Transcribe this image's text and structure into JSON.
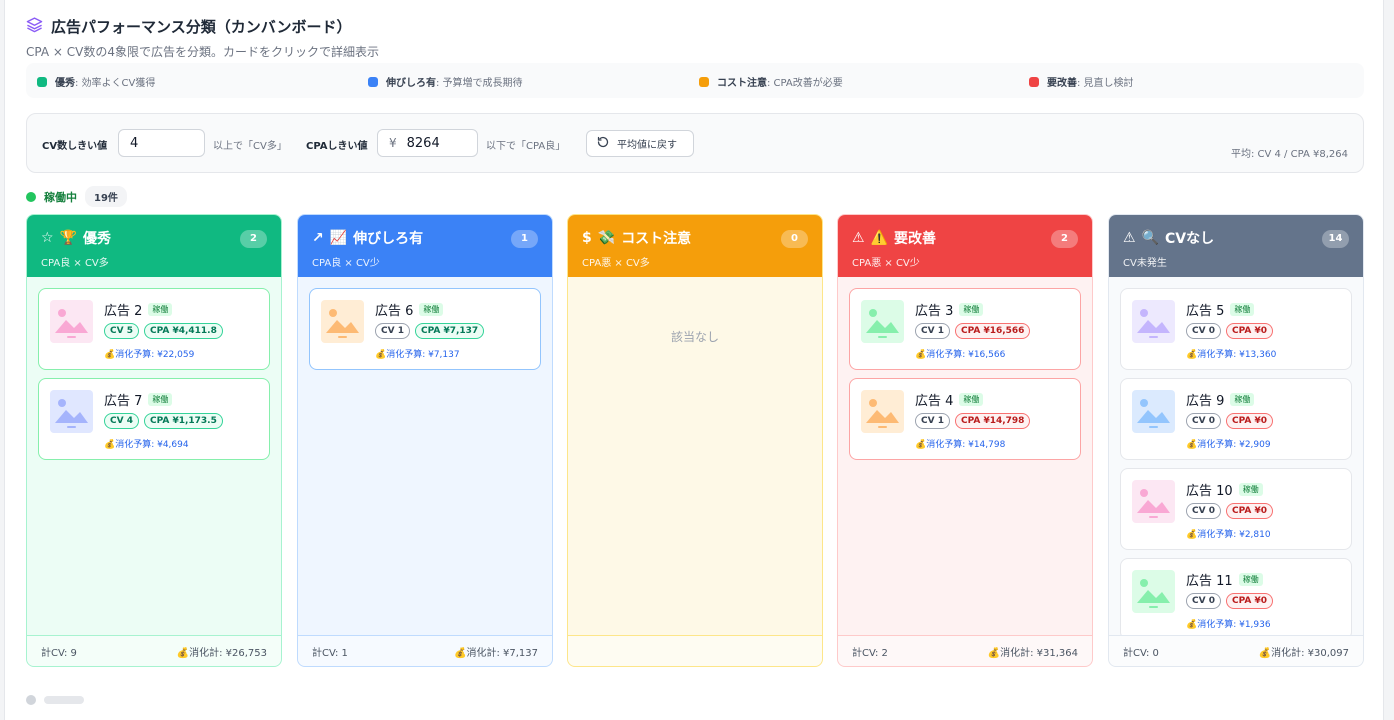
{
  "header": {
    "title": "広告パフォーマンス分類（カンバンボード）",
    "subtitle": "CPA × CV数の4象限で広告を分類。カードをクリックで詳細表示"
  },
  "legend": [
    {
      "label": "優秀",
      "desc": ": 効率よくCV獲得",
      "color": "#10b981"
    },
    {
      "label": "伸びしろ有",
      "desc": ": 予算増で成長期待",
      "color": "#3b82f6"
    },
    {
      "label": "コスト注意",
      "desc": ": CPA改善が必要",
      "color": "#f59e0b"
    },
    {
      "label": "要改善",
      "desc": ": 見直し検討",
      "color": "#ef4444"
    }
  ],
  "filter": {
    "cv_label": "CV数しきい値",
    "cv_value": "4",
    "cv_hint": "以上で「CV多」",
    "cpa_label": "CPAしきい値",
    "cpa_prefix": "¥",
    "cpa_value": "8264",
    "cpa_hint": "以下で「CPA良」",
    "reset_label": "平均値に戻す",
    "avg_text": "平均: CV 4 / CPA ¥8,264"
  },
  "section": {
    "label": "稼働中",
    "count": "19件"
  },
  "columns": [
    {
      "icon": "☆",
      "emoji": "🏆",
      "title": "優秀",
      "sub": "CPA良 × CV多",
      "count": "2",
      "head_color": "#10b981",
      "body_color": "#ecfdf5",
      "border_color": "#a7f3d0",
      "card_border": "#86efac",
      "foot_cv": "計CV: 9",
      "foot_cost": "💰消化計: ¥26,753",
      "cards": [
        {
          "name": "広告 2",
          "status": "稼働",
          "cv": "CV 5",
          "cpa": "CPA ¥4,411.8",
          "budget": "💰消化予算: ¥22,059",
          "thumb": "#fce7f3",
          "thumb_fg": "#f9a8d4",
          "cv_good": true,
          "cpa_good": true
        },
        {
          "name": "広告 7",
          "status": "稼働",
          "cv": "CV 4",
          "cpa": "CPA ¥1,173.5",
          "budget": "💰消化予算: ¥4,694",
          "thumb": "#e0e7ff",
          "thumb_fg": "#a5b4fc",
          "cv_good": true,
          "cpa_good": true
        }
      ]
    },
    {
      "icon": "↗",
      "emoji": "📈",
      "title": "伸びしろ有",
      "sub": "CPA良 × CV少",
      "count": "1",
      "head_color": "#3b82f6",
      "body_color": "#eff6ff",
      "border_color": "#bfdbfe",
      "card_border": "#93c5fd",
      "foot_cv": "計CV: 1",
      "foot_cost": "💰消化計: ¥7,137",
      "cards": [
        {
          "name": "広告 6",
          "status": "稼働",
          "cv": "CV 1",
          "cpa": "CPA ¥7,137",
          "budget": "💰消化予算: ¥7,137",
          "thumb": "#ffedd5",
          "thumb_fg": "#fdba74",
          "cv_good": false,
          "cpa_good": true
        }
      ]
    },
    {
      "icon": "$",
      "emoji": "💸",
      "title": "コスト注意",
      "sub": "CPA悪 × CV多",
      "count": "0",
      "head_color": "#f59e0b",
      "body_color": "#fef9e7",
      "border_color": "#fde68a",
      "card_border": "#fcd34d",
      "foot_cv": "",
      "foot_cost": "",
      "empty": "該当なし",
      "cards": []
    },
    {
      "icon": "⚠",
      "emoji": "⚠️",
      "title": "要改善",
      "sub": "CPA悪 × CV少",
      "count": "2",
      "head_color": "#ef4444",
      "body_color": "#fef2f2",
      "border_color": "#fecaca",
      "card_border": "#fca5a5",
      "foot_cv": "計CV: 2",
      "foot_cost": "💰消化計: ¥31,364",
      "cards": [
        {
          "name": "広告 3",
          "status": "稼働",
          "cv": "CV 1",
          "cpa": "CPA ¥16,566",
          "budget": "💰消化予算: ¥16,566",
          "thumb": "#dcfce7",
          "thumb_fg": "#86efac",
          "cv_good": false,
          "cpa_good": false
        },
        {
          "name": "広告 4",
          "status": "稼働",
          "cv": "CV 1",
          "cpa": "CPA ¥14,798",
          "budget": "💰消化予算: ¥14,798",
          "thumb": "#ffedd5",
          "thumb_fg": "#fdba74",
          "cv_good": false,
          "cpa_good": false
        }
      ]
    },
    {
      "icon": "⚠",
      "emoji": "🔍",
      "title": "CVなし",
      "sub": "CV未発生",
      "count": "14",
      "head_color": "#64748b",
      "body_color": "#f8fafc",
      "border_color": "#e2e8f0",
      "card_border": "#e5e7eb",
      "foot_cv": "計CV: 0",
      "foot_cost": "💰消化計: ¥30,097",
      "cards": [
        {
          "name": "広告 5",
          "status": "稼働",
          "cv": "CV 0",
          "cpa": "CPA ¥0",
          "budget": "💰消化予算: ¥13,360",
          "thumb": "#ede9fe",
          "thumb_fg": "#c4b5fd",
          "cv_good": false,
          "cpa_good": false
        },
        {
          "name": "広告 9",
          "status": "稼働",
          "cv": "CV 0",
          "cpa": "CPA ¥0",
          "budget": "💰消化予算: ¥2,909",
          "thumb": "#dbeafe",
          "thumb_fg": "#93c5fd",
          "cv_good": false,
          "cpa_good": false
        },
        {
          "name": "広告 10",
          "status": "稼働",
          "cv": "CV 0",
          "cpa": "CPA ¥0",
          "budget": "💰消化予算: ¥2,810",
          "thumb": "#fce7f3",
          "thumb_fg": "#f9a8d4",
          "cv_good": false,
          "cpa_good": false
        },
        {
          "name": "広告 11",
          "status": "稼働",
          "cv": "CV 0",
          "cpa": "CPA ¥0",
          "budget": "💰消化予算: ¥1,936",
          "thumb": "#dcfce7",
          "thumb_fg": "#86efac",
          "cv_good": false,
          "cpa_good": false
        }
      ]
    }
  ]
}
